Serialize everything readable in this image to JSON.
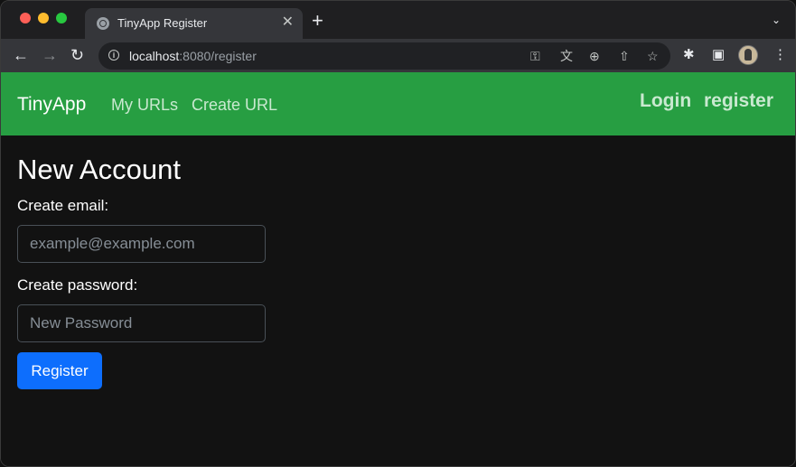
{
  "browser": {
    "tab_title": "TinyApp Register",
    "tab_close": "✕",
    "new_tab": "+",
    "tab_menu": "⌄",
    "url_host": "localhost",
    "url_rest": ":8080/register",
    "icons": {
      "back": "←",
      "forward": "→",
      "reload": "↻",
      "key": "⚿",
      "translate": "文",
      "zoom": "⊕",
      "share": "⇧",
      "star": "☆",
      "extensions": "✱",
      "sidebar": "▣",
      "menu": "⋮"
    }
  },
  "navbar": {
    "brand": "TinyApp",
    "links": [
      "My URLs",
      "Create URL"
    ],
    "login": "Login",
    "register": "register",
    "color": "#279e42"
  },
  "form": {
    "title": "New Account",
    "email_label": "Create email:",
    "email_placeholder": "example@example.com",
    "password_label": "Create password:",
    "password_placeholder": "New Password",
    "submit_label": "Register",
    "submit_color": "#0d6efd"
  }
}
